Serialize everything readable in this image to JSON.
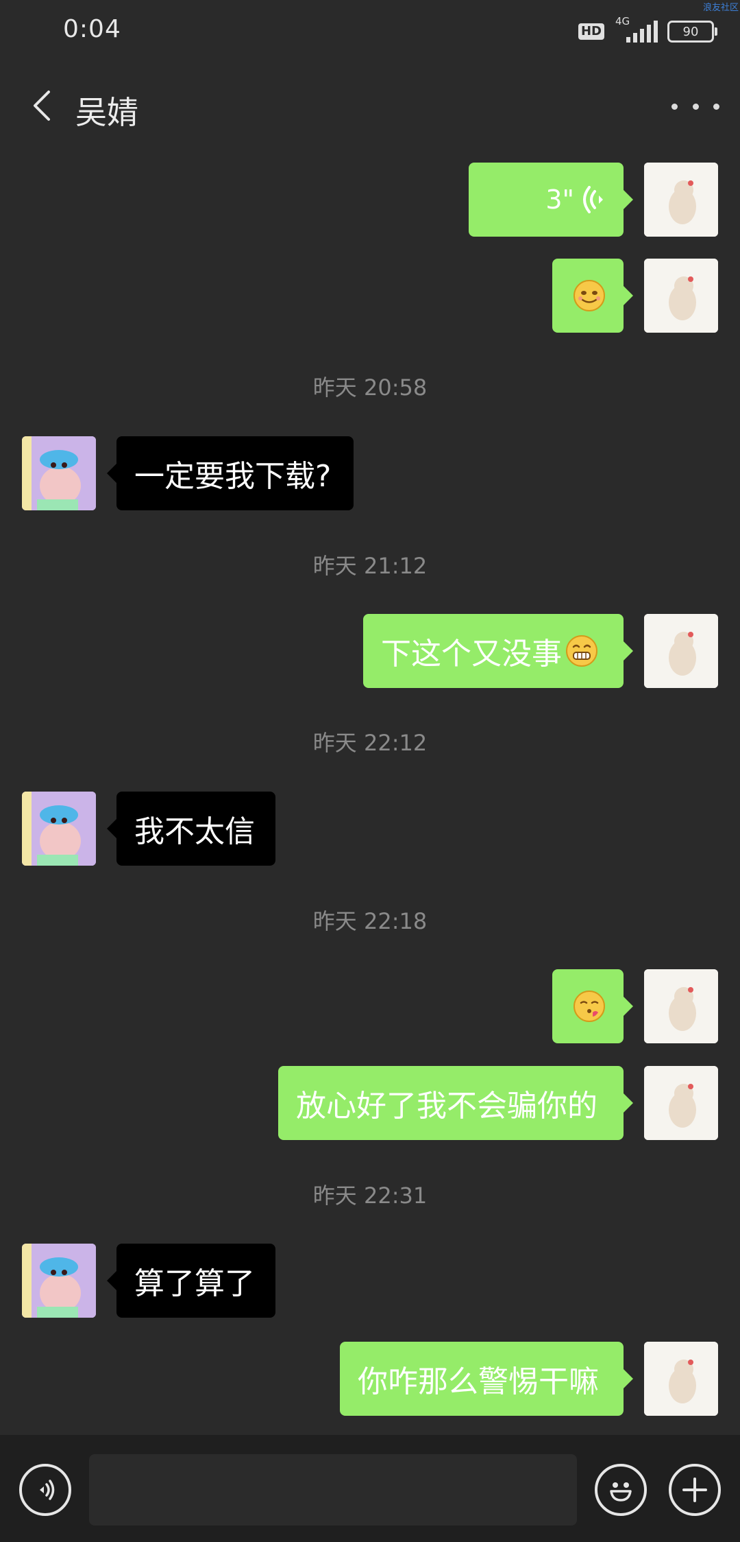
{
  "status_bar": {
    "time": "0:04",
    "hd": "HD",
    "network": "4G",
    "battery": "90",
    "watermark": "浪友社区"
  },
  "header": {
    "title": "吴婧"
  },
  "messages": [
    {
      "sender": "me",
      "type": "voice",
      "duration": "3\""
    },
    {
      "sender": "me",
      "type": "emoji",
      "emoji": "smile-emoji"
    },
    {
      "timestamp": "昨天 20:58"
    },
    {
      "sender": "them",
      "type": "text",
      "text": "一定要我下载?"
    },
    {
      "timestamp": "昨天 21:12"
    },
    {
      "sender": "me",
      "type": "text",
      "text": "下这个又没事",
      "emoji": "grin-emoji"
    },
    {
      "timestamp": "昨天 22:12"
    },
    {
      "sender": "them",
      "type": "text",
      "text": "我不太信"
    },
    {
      "timestamp": "昨天 22:18"
    },
    {
      "sender": "me",
      "type": "emoji",
      "emoji": "shy-emoji"
    },
    {
      "sender": "me",
      "type": "text",
      "text": "放心好了我不会骗你的"
    },
    {
      "timestamp": "昨天 22:31"
    },
    {
      "sender": "them",
      "type": "text",
      "text": "算了算了"
    },
    {
      "sender": "me",
      "type": "text",
      "text": "你咋那么警惕干嘛"
    }
  ],
  "colors": {
    "my_bubble": "#95ec69",
    "their_bubble": "#000000",
    "background": "#2a2a2a",
    "timestamp": "#8a8a8a"
  },
  "input": {
    "value": "",
    "placeholder": ""
  }
}
